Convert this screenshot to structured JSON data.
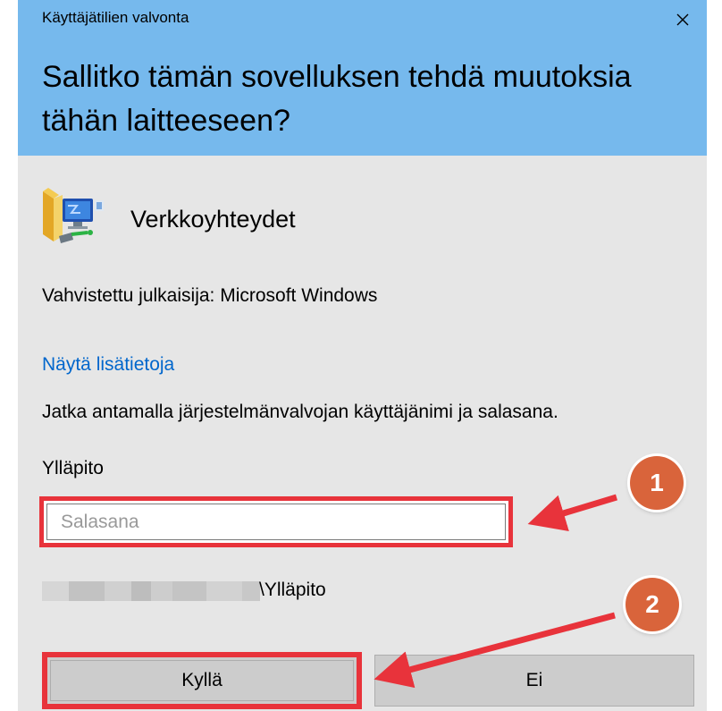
{
  "window": {
    "title": "Käyttäjätilien valvonta",
    "close_icon": "close-icon"
  },
  "prompt": {
    "question": "Sallitko tämän sovelluksen tehdä muutoksia tähän laitteeseen?"
  },
  "app": {
    "name": "Verkkoyhteydet",
    "icon": "network-connections-icon"
  },
  "publisher_text": "Vahvistettu julkaisija: Microsoft Windows",
  "more_info_link": "Näytä lisätietoja",
  "instruction": "Jatka antamalla järjestelmänvalvojan käyttäjänimi ja salasana.",
  "account": {
    "username": "Ylläpito",
    "password": {
      "value": "",
      "placeholder": "Salasana"
    },
    "domain_user": "\\Ylläpito"
  },
  "buttons": {
    "yes": "Kyllä",
    "no": "Ei"
  },
  "annotations": [
    {
      "label": "1",
      "target": "password-field"
    },
    {
      "label": "2",
      "target": "yes-button"
    }
  ],
  "colors": {
    "header": "#76b9ed",
    "background": "#e6e6e6",
    "link": "#0066cc",
    "highlight": "#e8333b",
    "badge": "#d9643b"
  }
}
